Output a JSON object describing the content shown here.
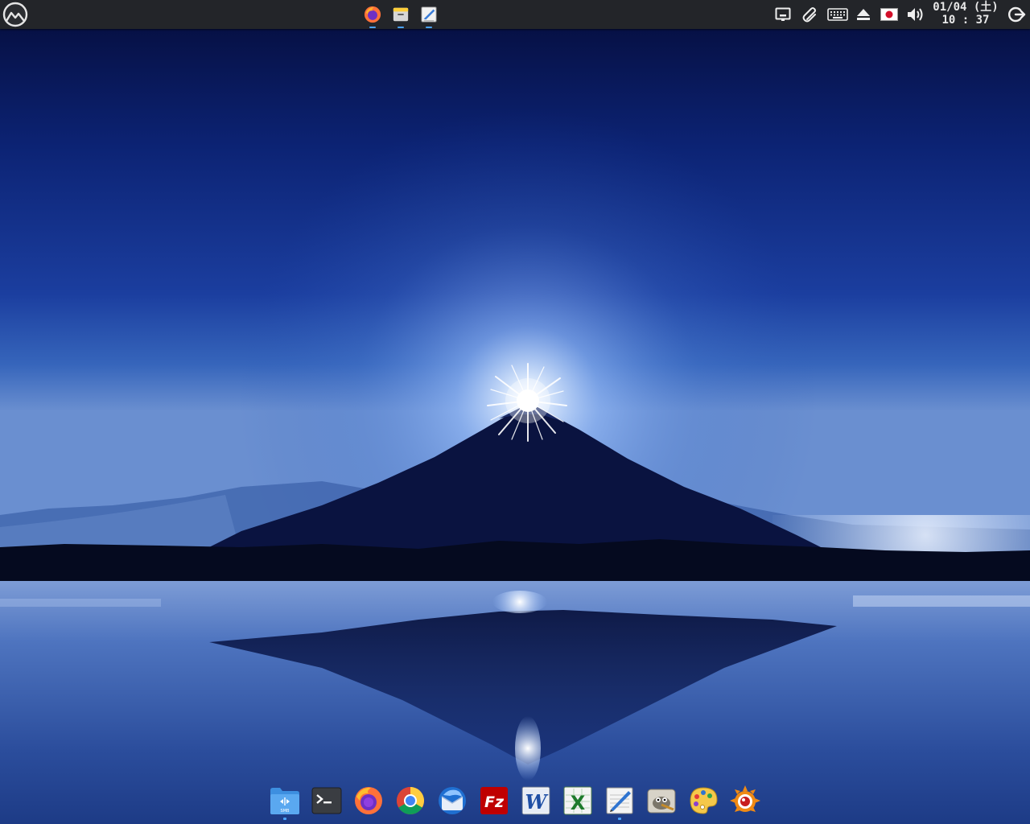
{
  "desktop": {
    "wallpaper": "mount-fuji-diamond-sunrise",
    "colors": {
      "sky_top": "#050c3a",
      "sky_mid": "#1c3d9e",
      "glow": "#b9d6ff",
      "mountain": "#0a1340",
      "panel": "#232529",
      "indicator": "#4aa3ff"
    }
  },
  "top_panel": {
    "menu_icon": "menu-logo-icon",
    "taskbar": [
      {
        "app": "Firefox",
        "icon": "firefox-icon",
        "running": true
      },
      {
        "app": "Files",
        "icon": "file-manager-icon",
        "running": true
      },
      {
        "app": "Text Editor",
        "icon": "text-editor-icon",
        "running": true
      }
    ],
    "tray": [
      {
        "name": "network",
        "icon": "network-icon"
      },
      {
        "name": "clipboard",
        "icon": "paperclip-icon"
      },
      {
        "name": "keyboard",
        "icon": "keyboard-icon"
      },
      {
        "name": "eject",
        "icon": "eject-icon"
      },
      {
        "name": "input-method",
        "icon": "japan-flag-icon"
      },
      {
        "name": "volume",
        "icon": "volume-icon"
      }
    ],
    "clock": {
      "date": "01/04 (土)",
      "time": "10 : 37"
    },
    "logout_icon": "logout-icon"
  },
  "dock": {
    "items": [
      {
        "app": "Files",
        "icon": "folder-smb-icon",
        "badge": "SMB",
        "running": true
      },
      {
        "app": "Terminal",
        "icon": "terminal-icon",
        "running": false
      },
      {
        "app": "Firefox",
        "icon": "firefox-icon",
        "running": false
      },
      {
        "app": "Chrome",
        "icon": "chrome-icon",
        "running": false
      },
      {
        "app": "Thunderbird",
        "icon": "thunderbird-icon",
        "running": false
      },
      {
        "app": "FileZilla",
        "icon": "filezilla-icon",
        "badge": "Fz",
        "running": false
      },
      {
        "app": "Writer",
        "icon": "word-icon",
        "badge": "W",
        "running": false
      },
      {
        "app": "Spreadsheet",
        "icon": "excel-icon",
        "badge": "X",
        "running": false
      },
      {
        "app": "Text Editor",
        "icon": "text-editor-icon",
        "running": true
      },
      {
        "app": "GIMP",
        "icon": "gimp-icon",
        "running": false
      },
      {
        "app": "Paint",
        "icon": "palette-icon",
        "running": false
      },
      {
        "app": "XnView",
        "icon": "xnview-icon",
        "running": false
      }
    ]
  }
}
